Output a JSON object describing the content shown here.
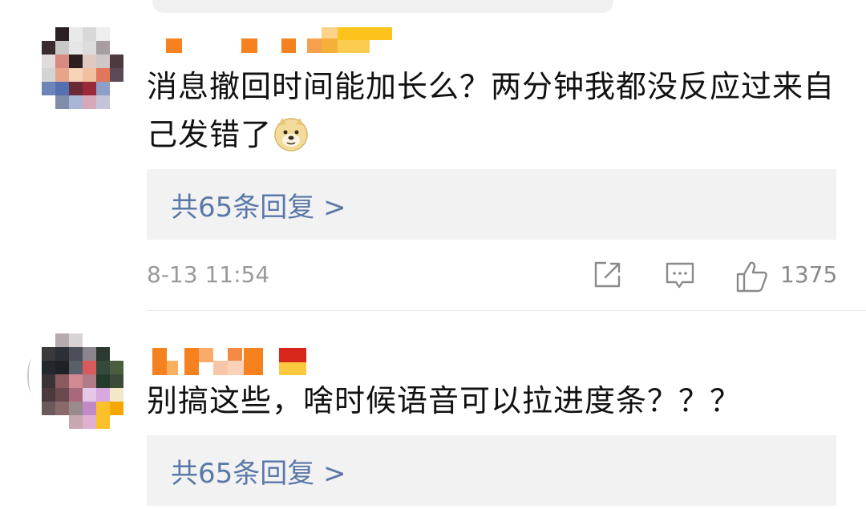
{
  "comments": [
    {
      "text": "消息撤回时间能加长么？两分钟我都没反应过来自己发错了",
      "emoji": "doge-emoji",
      "replies_label": "共65条回复 >",
      "timestamp": "8-13 11:54",
      "actions": {
        "share_icon": "share-icon",
        "comment_icon": "comment-icon",
        "like_icon": "thumbs-up-icon",
        "like_count": "1375"
      }
    },
    {
      "text": "别搞这些，啥时候语音可以拉进度条？？？",
      "replies_label": "共65条回复 >"
    }
  ],
  "colors": {
    "link": "#5a78a8",
    "reply_bg": "#f2f2f2",
    "meta": "#9a9a9a",
    "text": "#111111",
    "nickname_orange": "#f6821f"
  }
}
